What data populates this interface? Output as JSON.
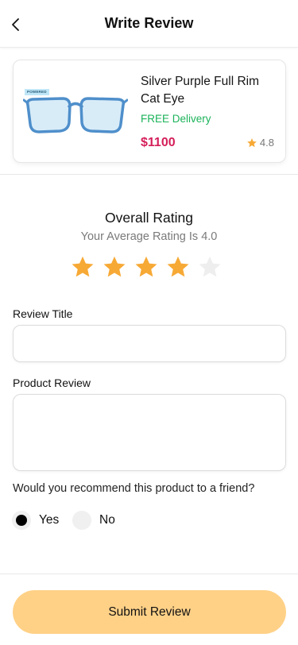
{
  "header": {
    "title": "Write Review",
    "back_icon": "chevron-left-icon"
  },
  "product": {
    "name": "Silver Purple Full Rim Cat Eye",
    "delivery": "FREE Delivery",
    "price": "$1100",
    "rating": "4.8",
    "image_badge": "POWERED",
    "colors": {
      "delivery": "#1cb35a",
      "price": "#d51f5a",
      "star": "#f7a935"
    }
  },
  "overall": {
    "title": "Overall Rating",
    "subtitle": "Your Average Rating Is 4.0",
    "stars_filled": 4,
    "stars_total": 5
  },
  "form": {
    "review_title_label": "Review Title",
    "review_title_value": "",
    "product_review_label": "Product Review",
    "product_review_value": ""
  },
  "recommend": {
    "question": "Would you recommend this product to a friend?",
    "options": [
      {
        "label": "Yes",
        "checked": true
      },
      {
        "label": "No",
        "checked": false
      }
    ]
  },
  "submit": {
    "label": "Submit Review",
    "color": "#ffd187"
  }
}
